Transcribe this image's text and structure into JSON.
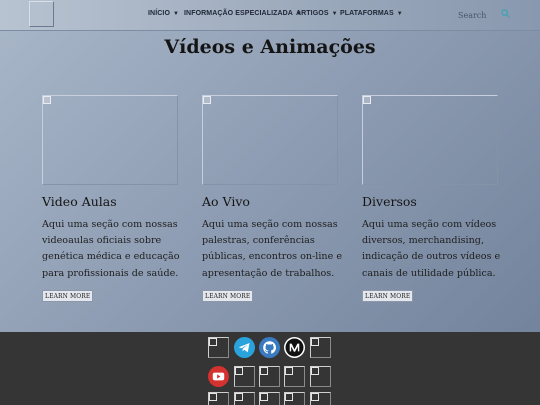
{
  "nav": {
    "items": [
      {
        "label": "INÍCIO",
        "has_dropdown": true
      },
      {
        "label": "INFORMAÇÃO ESPECIALIZADA",
        "has_dropdown": true
      },
      {
        "label": "ARTIGOS",
        "has_dropdown": true
      },
      {
        "label": "PLATAFORMAS",
        "has_dropdown": true
      }
    ],
    "caret": "▼",
    "search_placeholder": "Search",
    "search_icon": "search-icon"
  },
  "main": {
    "title": "Vídeos e Animações",
    "cards": [
      {
        "title": "Video Aulas",
        "text": "Aqui uma seção com nossas videoaulas oficiais sobre genética médica e educação para profissionais de saúde.",
        "button": "LEARN MORE"
      },
      {
        "title": "Ao Vivo",
        "text": "Aqui uma seção com nossas palestras, conferências públicas, encontros on-line e apresentação de trabalhos.",
        "button": "LEARN MORE"
      },
      {
        "title": "Diversos",
        "text": "Aqui uma seção com vídeos diversos, merchandising, indicação de outros vídeos e canais de utilidade pública.",
        "button": "LEARN MORE"
      }
    ]
  },
  "footer": {
    "social_icons": [
      "telegram-icon",
      "github-icon",
      "medium-icon",
      "youtube-icon"
    ],
    "colors": {
      "telegram": "#2aa3dd",
      "github": "#3a7ac1",
      "medium": "#111111",
      "youtube": "#d3322f"
    }
  },
  "colors": {
    "header_bg": "#a6b3c4",
    "body_bg_start": "#a9b7c9",
    "body_bg_end": "#6e7f98",
    "footer_bg": "#353535",
    "search_icon_accent": "#3fa3b5"
  }
}
